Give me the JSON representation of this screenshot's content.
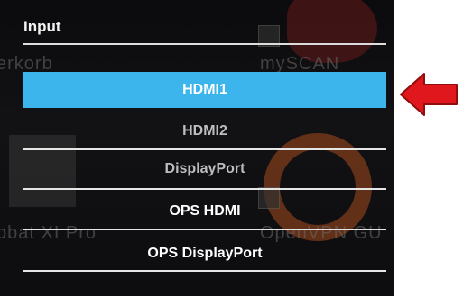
{
  "osd": {
    "title": "Input",
    "items": [
      {
        "label": "HDMI1",
        "state": "selected"
      },
      {
        "label": "HDMI2",
        "state": "normal"
      },
      {
        "label": "DisplayPort",
        "state": "normal"
      },
      {
        "label": "OPS HDMI",
        "state": "normal"
      },
      {
        "label": "OPS DisplayPort",
        "state": "normal"
      }
    ]
  },
  "background_desktop": {
    "labels": [
      "erkorb",
      "mySCAN",
      "obat XI Pro",
      "OpenVPN GU"
    ]
  },
  "colors": {
    "selected_highlight": "#3cb4ec",
    "annotation_arrow": "#e0171d",
    "screen_background": "#0d0d10"
  },
  "annotation": {
    "icon": "left-arrow-icon"
  }
}
